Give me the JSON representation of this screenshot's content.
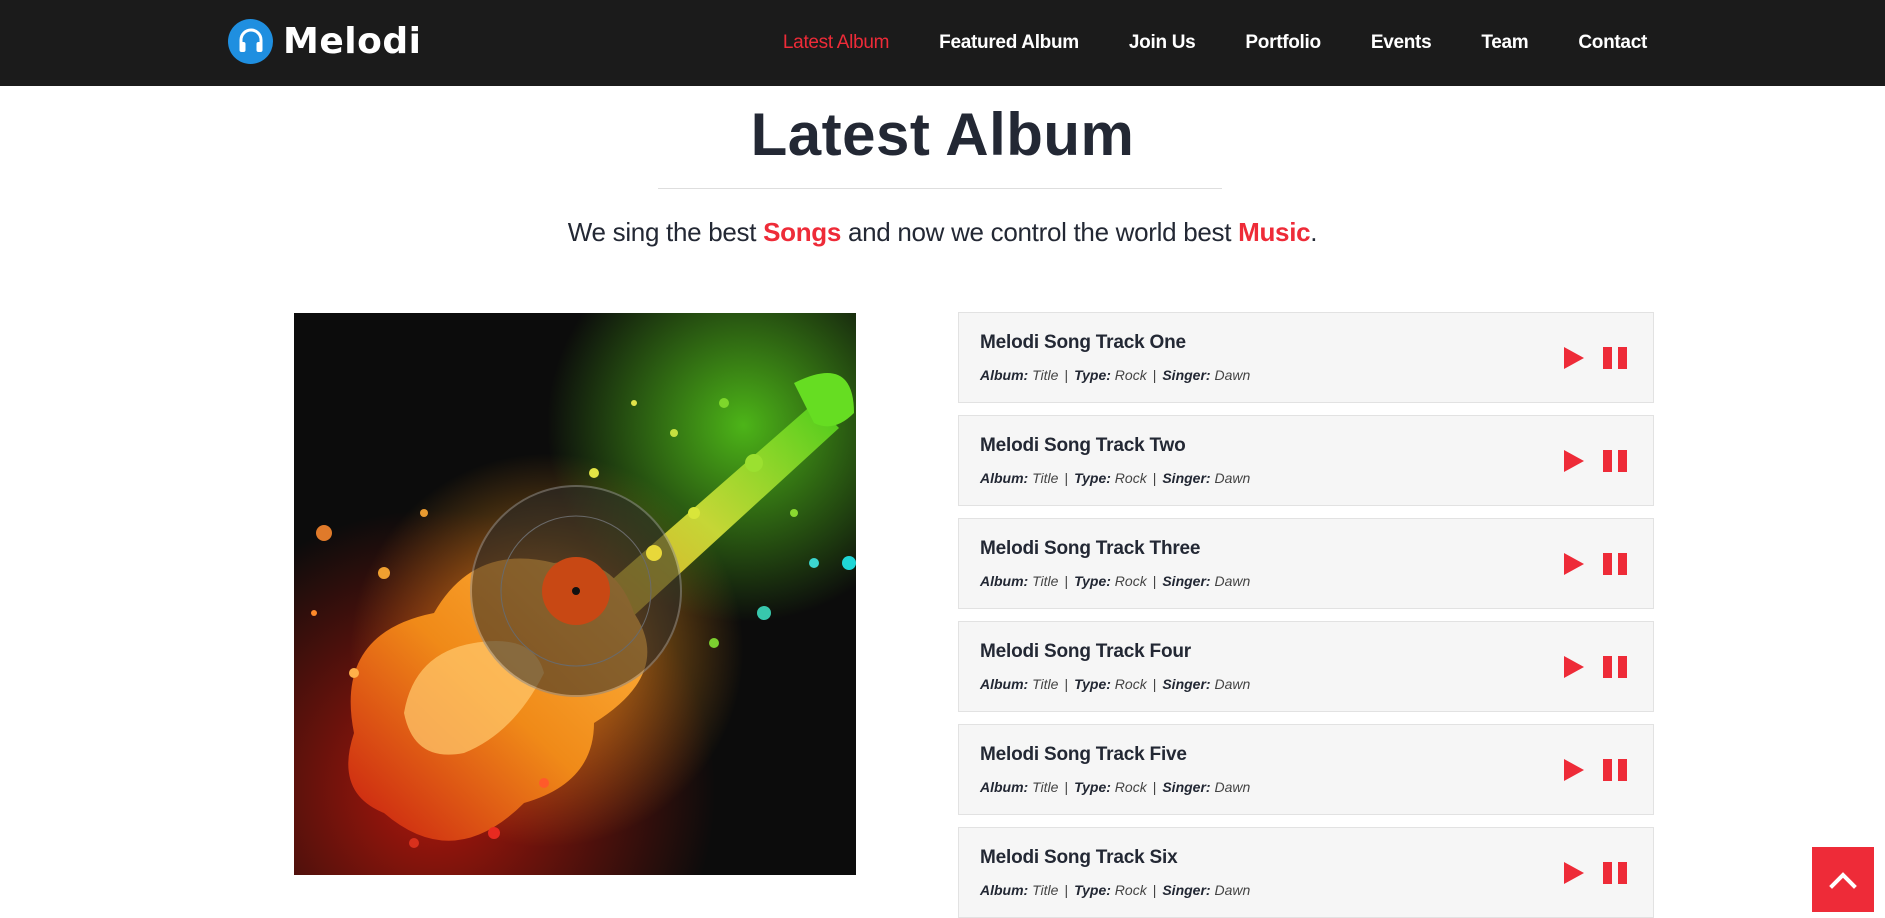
{
  "brand": {
    "name": "Melodi",
    "logo_icon": "headphones-icon"
  },
  "nav": {
    "items": [
      {
        "label": "Latest Album",
        "active": true
      },
      {
        "label": "Featured Album",
        "active": false
      },
      {
        "label": "Join Us",
        "active": false
      },
      {
        "label": "Portfolio",
        "active": false
      },
      {
        "label": "Events",
        "active": false
      },
      {
        "label": "Team",
        "active": false
      },
      {
        "label": "Contact",
        "active": false
      }
    ]
  },
  "section": {
    "title": "Latest Album",
    "subtitle": {
      "part1": "We sing the best ",
      "highlight1": "Songs",
      "part2": " and now we control the world best ",
      "highlight2": "Music",
      "part3": "."
    }
  },
  "album_art": {
    "icon": "guitar-art-image"
  },
  "tracks": [
    {
      "title": "Melodi Song Track One",
      "album_label": "Album:",
      "album": "Title",
      "type_label": "Type:",
      "type": "Rock",
      "singer_label": "Singer:",
      "singer": "Dawn"
    },
    {
      "title": "Melodi Song Track Two",
      "album_label": "Album:",
      "album": "Title",
      "type_label": "Type:",
      "type": "Rock",
      "singer_label": "Singer:",
      "singer": "Dawn"
    },
    {
      "title": "Melodi Song Track Three",
      "album_label": "Album:",
      "album": "Title",
      "type_label": "Type:",
      "type": "Rock",
      "singer_label": "Singer:",
      "singer": "Dawn"
    },
    {
      "title": "Melodi Song Track Four",
      "album_label": "Album:",
      "album": "Title",
      "type_label": "Type:",
      "type": "Rock",
      "singer_label": "Singer:",
      "singer": "Dawn"
    },
    {
      "title": "Melodi Song Track Five",
      "album_label": "Album:",
      "album": "Title",
      "type_label": "Type:",
      "type": "Rock",
      "singer_label": "Singer:",
      "singer": "Dawn"
    },
    {
      "title": "Melodi Song Track Six",
      "album_label": "Album:",
      "album": "Title",
      "type_label": "Type:",
      "type": "Rock",
      "singer_label": "Singer:",
      "singer": "Dawn"
    }
  ],
  "controls": {
    "play_icon": "play-icon",
    "pause_icon": "pause-icon",
    "scroll_top_icon": "chevron-up-icon"
  },
  "colors": {
    "accent": "#ee2b38",
    "navbar": "#1b1b1b",
    "text": "#232834",
    "logo": "#1f8fe0",
    "track_bg": "#f6f6f6"
  }
}
